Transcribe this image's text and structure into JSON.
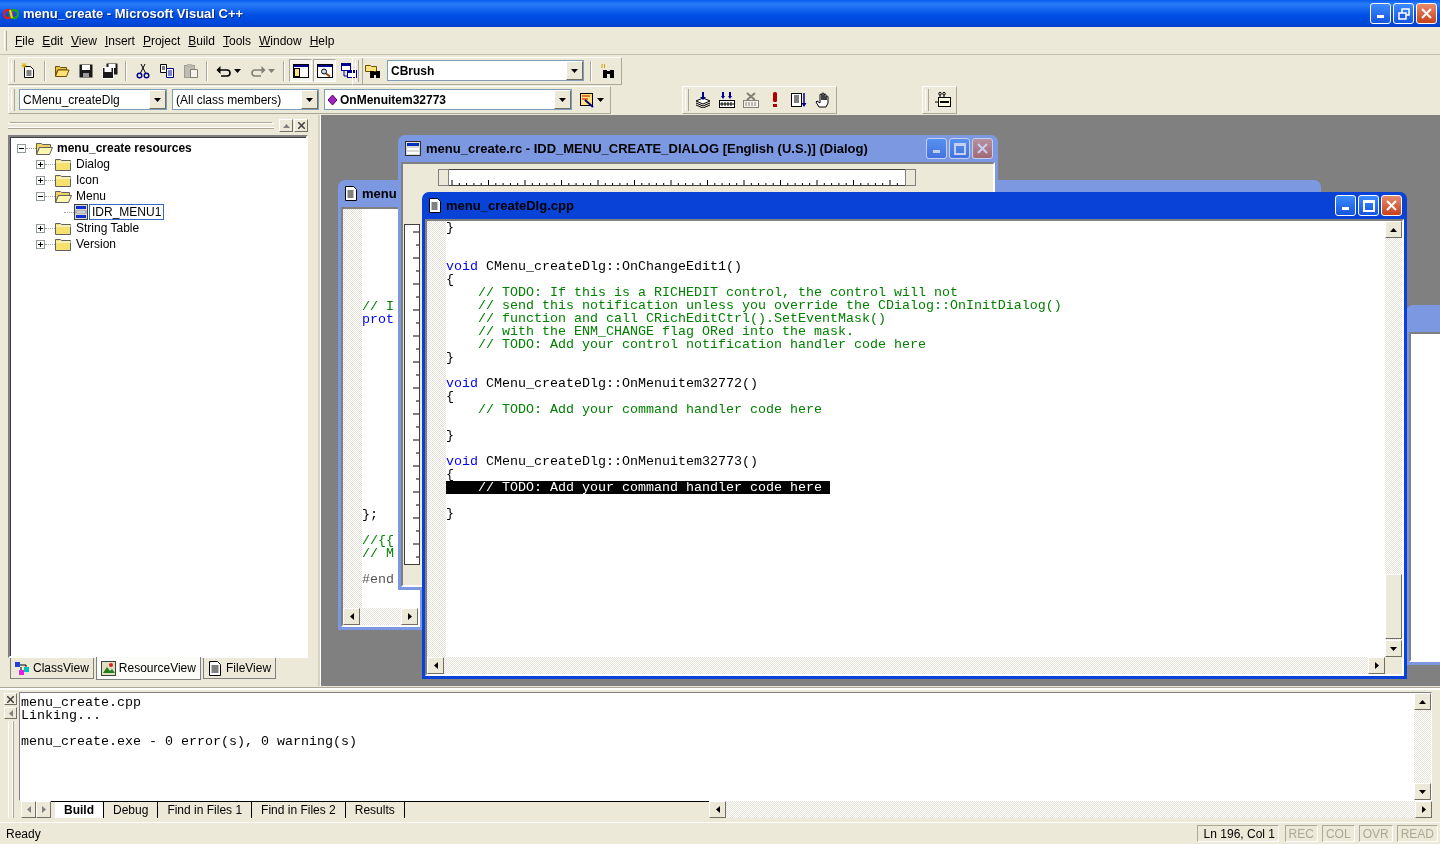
{
  "window": {
    "title": "menu_create - Microsoft Visual C++"
  },
  "menu_bar": [
    "File",
    "Edit",
    "View",
    "Insert",
    "Project",
    "Build",
    "Tools",
    "Window",
    "Help"
  ],
  "toolbars": [
    {
      "items": [
        {
          "kind": "new",
          "disabled": false,
          "pressed": false
        },
        {
          "kind": "separator"
        },
        {
          "kind": "open",
          "disabled": false,
          "pressed": false
        },
        {
          "kind": "save",
          "disabled": false,
          "pressed": false
        },
        {
          "kind": "save-all",
          "disabled": false,
          "pressed": false
        },
        {
          "kind": "separator"
        },
        {
          "kind": "cut",
          "disabled": false,
          "pressed": false
        },
        {
          "kind": "copy",
          "disabled": false,
          "pressed": false
        },
        {
          "kind": "paste",
          "disabled": true,
          "pressed": false
        },
        {
          "kind": "separator"
        },
        {
          "kind": "undo",
          "disabled": false,
          "pressed": false
        },
        {
          "kind": "redo",
          "disabled": true,
          "pressed": false
        },
        {
          "kind": "separator"
        },
        {
          "kind": "workspace",
          "disabled": false,
          "pressed": true
        },
        {
          "kind": "output",
          "disabled": false,
          "pressed": true
        },
        {
          "kind": "window-list",
          "disabled": false,
          "pressed": false
        }
      ]
    },
    {
      "items": [
        {
          "kind": "find-in-files",
          "disabled": false,
          "pressed": false
        },
        {
          "kind": "find-combo",
          "value": "CBrush"
        },
        {
          "kind": "separator"
        },
        {
          "kind": "search",
          "disabled": false,
          "pressed": false
        }
      ]
    },
    {
      "items": [
        {
          "kind": "class-combo",
          "value": "CMenu_createDlg"
        },
        {
          "kind": "filter-combo",
          "value": "(All class members)"
        },
        {
          "kind": "member-combo",
          "value": "OnMenuitem32773"
        },
        {
          "kind": "wizard",
          "disabled": false,
          "pressed": false
        }
      ]
    },
    {
      "items": [
        {
          "kind": "compile",
          "disabled": false,
          "pressed": false
        },
        {
          "kind": "build",
          "disabled": false,
          "pressed": false
        },
        {
          "kind": "stop",
          "disabled": true,
          "pressed": false
        },
        {
          "kind": "execute",
          "disabled": false,
          "pressed": false
        },
        {
          "kind": "go",
          "disabled": false,
          "pressed": false
        },
        {
          "kind": "hand",
          "disabled": false,
          "pressed": false
        }
      ]
    },
    {
      "items": [
        {
          "kind": "atl",
          "disabled": false,
          "pressed": false
        }
      ]
    }
  ],
  "workspace": {
    "tree": {
      "label": "menu_create resources",
      "kind": "folder",
      "expanded": true,
      "selected": false,
      "children": [
        {
          "label": "Dialog",
          "kind": "folder",
          "expanded": false,
          "selected": false
        },
        {
          "label": "Icon",
          "kind": "folder",
          "expanded": false,
          "selected": false
        },
        {
          "label": "Menu",
          "kind": "folder",
          "expanded": true,
          "selected": false,
          "children": [
            {
              "label": "IDR_MENU1",
              "kind": "menu",
              "selected": true
            }
          ]
        },
        {
          "label": "String Table",
          "kind": "folder",
          "expanded": false,
          "selected": false
        },
        {
          "label": "Version",
          "kind": "folder",
          "expanded": false,
          "selected": false
        }
      ]
    },
    "tabs": [
      {
        "label": "ClassView",
        "kind": "class",
        "selected": false
      },
      {
        "label": "ResourceView",
        "kind": "resource",
        "selected": true
      },
      {
        "label": "FileView",
        "kind": "file",
        "selected": false
      }
    ]
  },
  "windows": [
    {
      "kind": "blank",
      "active": false
    },
    {
      "kind": "blank",
      "active": false
    },
    {
      "kind": "code",
      "title": "menu",
      "active": false,
      "lines": [
        {
          "kind": "blank"
        },
        {
          "kind": "blank"
        },
        {
          "kind": "blank"
        },
        {
          "kind": "blank"
        },
        {
          "kind": "blank"
        },
        {
          "kind": "blank"
        },
        {
          "kind": "blank"
        },
        {
          "kind": "comment",
          "text": "// I"
        },
        {
          "kind": "keyword",
          "text": "prot"
        },
        {
          "kind": "blank"
        },
        {
          "kind": "blank"
        },
        {
          "kind": "blank"
        },
        {
          "kind": "blank"
        },
        {
          "kind": "blank"
        },
        {
          "kind": "blank"
        },
        {
          "kind": "blank"
        },
        {
          "kind": "blank"
        },
        {
          "kind": "blank"
        },
        {
          "kind": "blank"
        },
        {
          "kind": "blank"
        },
        {
          "kind": "blank"
        },
        {
          "kind": "blank"
        },
        {
          "kind": "blank"
        },
        {
          "kind": "code",
          "text": "};"
        },
        {
          "kind": "blank"
        },
        {
          "kind": "comment",
          "text": "//{{"
        },
        {
          "kind": "comment",
          "text": "// M"
        },
        {
          "kind": "blank"
        },
        {
          "kind": "preproc",
          "text": "#end"
        }
      ]
    },
    {
      "kind": "dialog",
      "title": "menu_create.rc - IDD_MENU_CREATE_DIALOG [English (U.S.)] (Dialog)",
      "active": false
    },
    {
      "kind": "code",
      "title": "menu_createDlg.cpp",
      "active": true,
      "lines": [
        {
          "kind": "code",
          "text": "}",
          "selected": false
        },
        {
          "kind": "blank"
        },
        {
          "kind": "blank"
        },
        {
          "kind": "code",
          "keyword": "void",
          "text": " CMenu_createDlg::OnChangeEdit1()",
          "selected": false
        },
        {
          "kind": "code",
          "text": "{",
          "selected": false
        },
        {
          "kind": "comment",
          "text": "    // TODO: If this is a RICHEDIT control, the control will not",
          "selected": false
        },
        {
          "kind": "comment",
          "text": "    // send this notification unless you override the CDialog::OnInitDialog()",
          "selected": false
        },
        {
          "kind": "comment",
          "text": "    // function and call CRichEditCtrl().SetEventMask()",
          "selected": false
        },
        {
          "kind": "comment",
          "text": "    // with the ENM_CHANGE flag ORed into the mask.",
          "selected": false
        },
        {
          "kind": "comment",
          "text": "    // TODO: Add your control notification handler code here",
          "selected": false
        },
        {
          "kind": "code",
          "text": "}",
          "selected": false
        },
        {
          "kind": "blank"
        },
        {
          "kind": "code",
          "keyword": "void",
          "text": " CMenu_createDlg::OnMenuitem32772()",
          "selected": false
        },
        {
          "kind": "code",
          "text": "{",
          "selected": false
        },
        {
          "kind": "comment",
          "text": "    // TODO: Add your command handler code here",
          "selected": false
        },
        {
          "kind": "blank"
        },
        {
          "kind": "code",
          "text": "}",
          "selected": false
        },
        {
          "kind": "blank"
        },
        {
          "kind": "code",
          "keyword": "void",
          "text": " CMenu_createDlg::OnMenuitem32773()",
          "selected": false
        },
        {
          "kind": "code",
          "text": "{",
          "selected": false
        },
        {
          "kind": "comment",
          "text": "    // TODO: Add your command handler code here",
          "selected": true
        },
        {
          "kind": "blank"
        },
        {
          "kind": "code",
          "text": "}",
          "selected": false
        }
      ]
    }
  ],
  "output": {
    "lines": [
      {
        "kind": "text",
        "text": "menu_create.cpp"
      },
      {
        "kind": "text",
        "text": "Linking..."
      },
      {
        "kind": "blank"
      },
      {
        "kind": "text",
        "text": "menu_create.exe - 0 error(s), 0 warning(s)"
      }
    ],
    "tabs": [
      {
        "label": "Build",
        "selected": true
      },
      {
        "label": "Debug",
        "selected": false
      },
      {
        "label": "Find in Files 1",
        "selected": false
      },
      {
        "label": "Find in Files 2",
        "selected": false
      },
      {
        "label": "Results",
        "selected": false
      }
    ]
  },
  "status_bar": {
    "message": "Ready",
    "position": "Ln 196, Col 1",
    "indicators": [
      {
        "label": "REC",
        "disabled": true
      },
      {
        "label": "COL",
        "disabled": true
      },
      {
        "label": "OVR",
        "disabled": true
      },
      {
        "label": "READ",
        "disabled": true
      }
    ]
  }
}
